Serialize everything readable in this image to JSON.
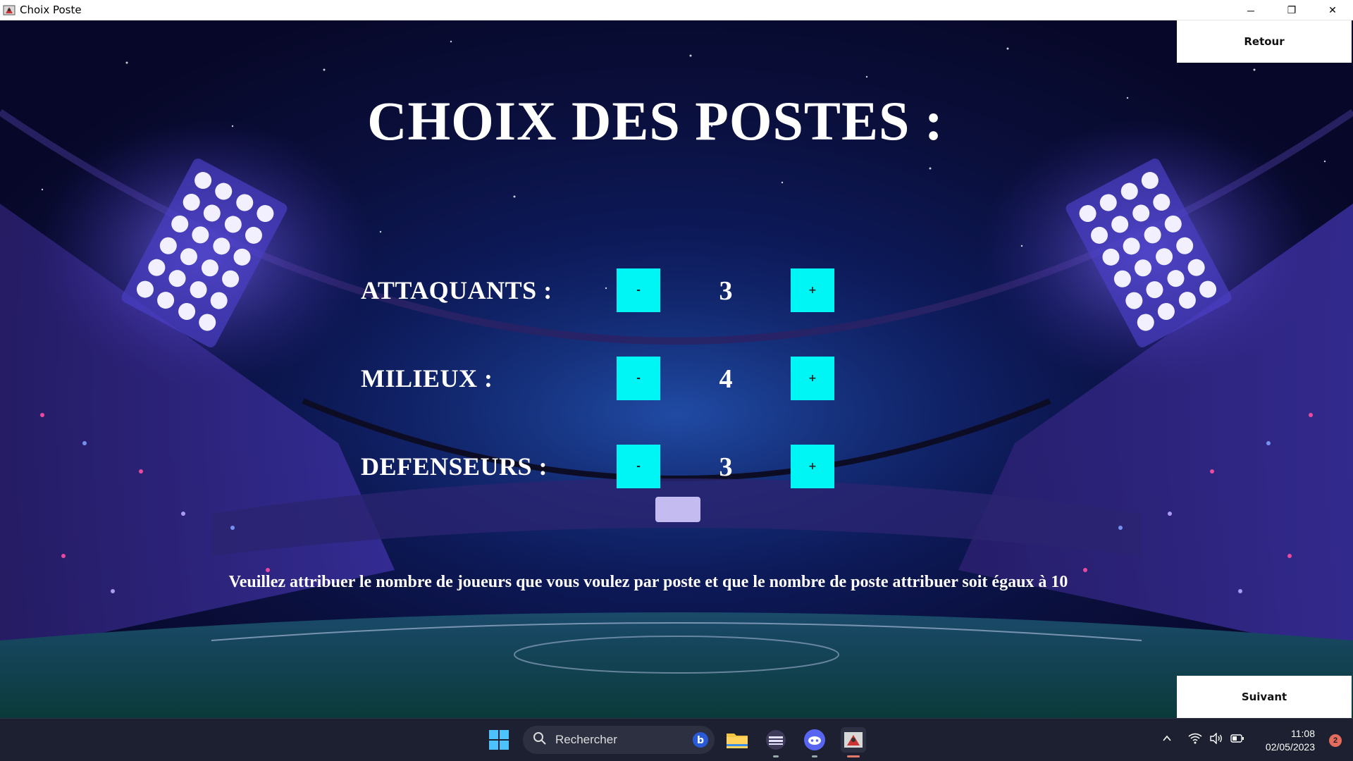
{
  "window": {
    "title": "Choix Poste",
    "controls": {
      "minimize": "─",
      "maximize": "❐",
      "close": "✕"
    }
  },
  "nav": {
    "back_label": "Retour",
    "next_label": "Suivant"
  },
  "main": {
    "title": "CHOIX DES POSTES :",
    "rows": [
      {
        "label": "ATTAQUANTS :",
        "value": "3",
        "minus": "-",
        "plus": "+"
      },
      {
        "label": "MILIEUX :",
        "value": "4",
        "minus": "-",
        "plus": "+"
      },
      {
        "label": "DEFENSEURS :",
        "value": "3",
        "minus": "-",
        "plus": "+"
      }
    ],
    "instruction": "Veuillez attribuer le nombre de joueurs que vous voulez par poste et que le nombre de poste attribuer soit égaux à 10"
  },
  "taskbar": {
    "search_placeholder": "Rechercher",
    "time": "11:08",
    "date": "02/05/2023",
    "notification_count": "2",
    "icons": [
      "windows-start-icon",
      "search-icon",
      "bing-icon",
      "file-explorer-icon",
      "app-icon",
      "discord-icon",
      "java-app-icon"
    ]
  },
  "colors": {
    "accent_cyan": "#00f5f5",
    "background_navy": "#0a0f3c",
    "text_white": "#ffffff"
  }
}
